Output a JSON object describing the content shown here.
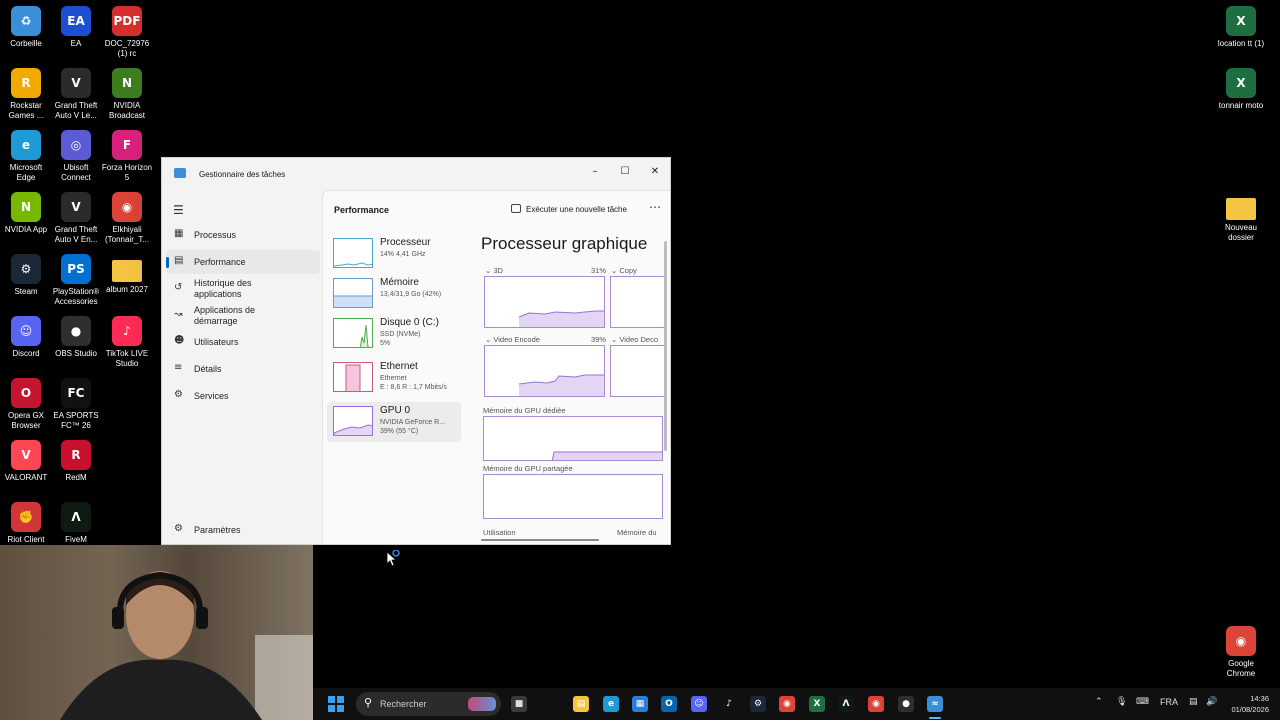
{
  "desktop": {
    "icons": [
      {
        "label": "Corbeille",
        "icon": "recycle-bin-icon",
        "color": "#3a8fd8"
      },
      {
        "label": "EA",
        "icon": "ea-icon",
        "color": "#1f4fd1"
      },
      {
        "label": "DOC_72976 (1) rc",
        "icon": "pdf-icon",
        "color": "#d32f2f"
      },
      {
        "label": "Rockstar Games ...",
        "icon": "rockstar-icon",
        "color": "#f2a900"
      },
      {
        "label": "Grand Theft Auto V Le...",
        "icon": "gta-icon",
        "color": "#2b2b2b"
      },
      {
        "label": "NVIDIA Broadcast",
        "icon": "nvidia-broadcast-icon",
        "color": "#3b7d1f"
      },
      {
        "label": "Microsoft Edge",
        "icon": "edge-icon",
        "color": "#1e9ad6"
      },
      {
        "label": "Ubisoft Connect",
        "icon": "ubisoft-icon",
        "color": "#5b5bd6"
      },
      {
        "label": "Forza Horizon 5",
        "icon": "forza-icon",
        "color": "#d6217d"
      },
      {
        "label": "NVIDIA App",
        "icon": "nvidia-icon",
        "color": "#76b900"
      },
      {
        "label": "Grand Theft Auto V En...",
        "icon": "gta-icon",
        "color": "#2b2b2b"
      },
      {
        "label": "Elkhiyali (Tonnair_T...",
        "icon": "chrome-icon",
        "color": "#db4437"
      },
      {
        "label": "Steam",
        "icon": "steam-icon",
        "color": "#1b2838"
      },
      {
        "label": "PlayStation® Accessories",
        "icon": "playstation-icon",
        "color": "#0070d1"
      },
      {
        "label": "album 2027",
        "icon": "folder-icon",
        "color": "#f4c542"
      },
      {
        "label": "Discord",
        "icon": "discord-icon",
        "color": "#5865f2"
      },
      {
        "label": "OBS Studio",
        "icon": "obs-icon",
        "color": "#302e31"
      },
      {
        "label": "TikTok LIVE Studio",
        "icon": "tiktok-icon",
        "color": "#fe2c55"
      },
      {
        "label": "Opera GX Browser",
        "icon": "opera-gx-icon",
        "color": "#c3162e"
      },
      {
        "label": "EA SPORTS FC™ 26",
        "icon": "ea-fc-icon",
        "color": "#111111"
      },
      {
        "label": "VALORANT",
        "icon": "valorant-icon",
        "color": "#ff4655"
      },
      {
        "label": "RedM",
        "icon": "redm-icon",
        "color": "#c8102e"
      },
      {
        "label": "Riot Client",
        "icon": "riot-icon",
        "color": "#d13639"
      },
      {
        "label": "FiveM",
        "icon": "fivem-icon",
        "color": "#0f1a12"
      },
      {
        "label": "location tt (1)",
        "icon": "excel-icon",
        "color": "#1d6f42"
      },
      {
        "label": "tonnair moto",
        "icon": "excel-icon",
        "color": "#1d6f42"
      },
      {
        "label": "Nouveau dossier",
        "icon": "folder-icon",
        "color": "#f4c542"
      },
      {
        "label": "Google Chrome",
        "icon": "chrome-icon",
        "color": "#db4437"
      }
    ]
  },
  "taskmanager": {
    "title": "Gestionnaire des tâches",
    "nav": [
      {
        "label": "Processus",
        "icon": "processes-icon"
      },
      {
        "label": "Performance",
        "icon": "performance-icon"
      },
      {
        "label": "Historique des applications",
        "icon": "history-icon"
      },
      {
        "label": "Applications de démarrage",
        "icon": "startup-icon"
      },
      {
        "label": "Utilisateurs",
        "icon": "users-icon"
      },
      {
        "label": "Détails",
        "icon": "details-icon"
      },
      {
        "label": "Services",
        "icon": "services-icon"
      },
      {
        "label": "Paramètres",
        "icon": "settings-icon"
      }
    ],
    "page_title": "Performance",
    "run_task": "Exécuter une nouvelle tâche",
    "resources": [
      {
        "name": "Processeur",
        "sub1": "14% 4,41 GHz",
        "sub2": "",
        "color": "#4aa9c9"
      },
      {
        "name": "Mémoire",
        "sub1": "13,4/31,9 Go (42%)",
        "sub2": "",
        "color": "#6a9ad6"
      },
      {
        "name": "Disque 0 (C:)",
        "sub1": "SSD (NVMe)",
        "sub2": "5%",
        "color": "#4caf50"
      },
      {
        "name": "Ethernet",
        "sub1": "Ethernet",
        "sub2": "E : 8,6 R : 1,7 Mbits/s",
        "color": "#c85a8a"
      },
      {
        "name": "GPU 0",
        "sub1": "NVIDIA GeForce R...",
        "sub2": "39% (55 °C)",
        "color": "#9b6fd6"
      }
    ],
    "gpu": {
      "title": "Processeur graphique",
      "engines": [
        {
          "label": "3D",
          "percent": "31%",
          "level": 0.31
        },
        {
          "label": "Copy",
          "percent": "",
          "level": 0
        },
        {
          "label": "Video Encode",
          "percent": "39%",
          "level": 0.39
        },
        {
          "label": "Video Deco",
          "percent": "",
          "level": 0
        }
      ],
      "dedicated_label": "Mémoire du GPU dédiée",
      "shared_label": "Mémoire du GPU partagée",
      "bottom_left": "Utilisation",
      "bottom_right": "Mémoire du"
    }
  },
  "taskbar": {
    "search_placeholder": "Rechercher",
    "language": "FRA",
    "time": "14:36",
    "date": "01/08/2026",
    "apps": [
      {
        "icon": "file-explorer-icon",
        "color": "#f4c542"
      },
      {
        "icon": "edge-icon",
        "color": "#1e9ad6"
      },
      {
        "icon": "store-icon",
        "color": "#2d7cd6"
      },
      {
        "icon": "outlook-icon",
        "color": "#0a64ad"
      },
      {
        "icon": "discord-icon",
        "color": "#5865f2"
      },
      {
        "icon": "tiktok-icon",
        "color": "#111111"
      },
      {
        "icon": "steam-icon",
        "color": "#1b2838"
      },
      {
        "icon": "chrome-icon",
        "color": "#db4437"
      },
      {
        "icon": "excel-icon",
        "color": "#1d6f42"
      },
      {
        "icon": "fivem-icon",
        "color": "#0f1a12"
      },
      {
        "icon": "chrome-icon",
        "color": "#db4437"
      },
      {
        "icon": "obs-icon",
        "color": "#302e31"
      },
      {
        "icon": "task-manager-icon",
        "color": "#3a8fd8"
      }
    ]
  }
}
